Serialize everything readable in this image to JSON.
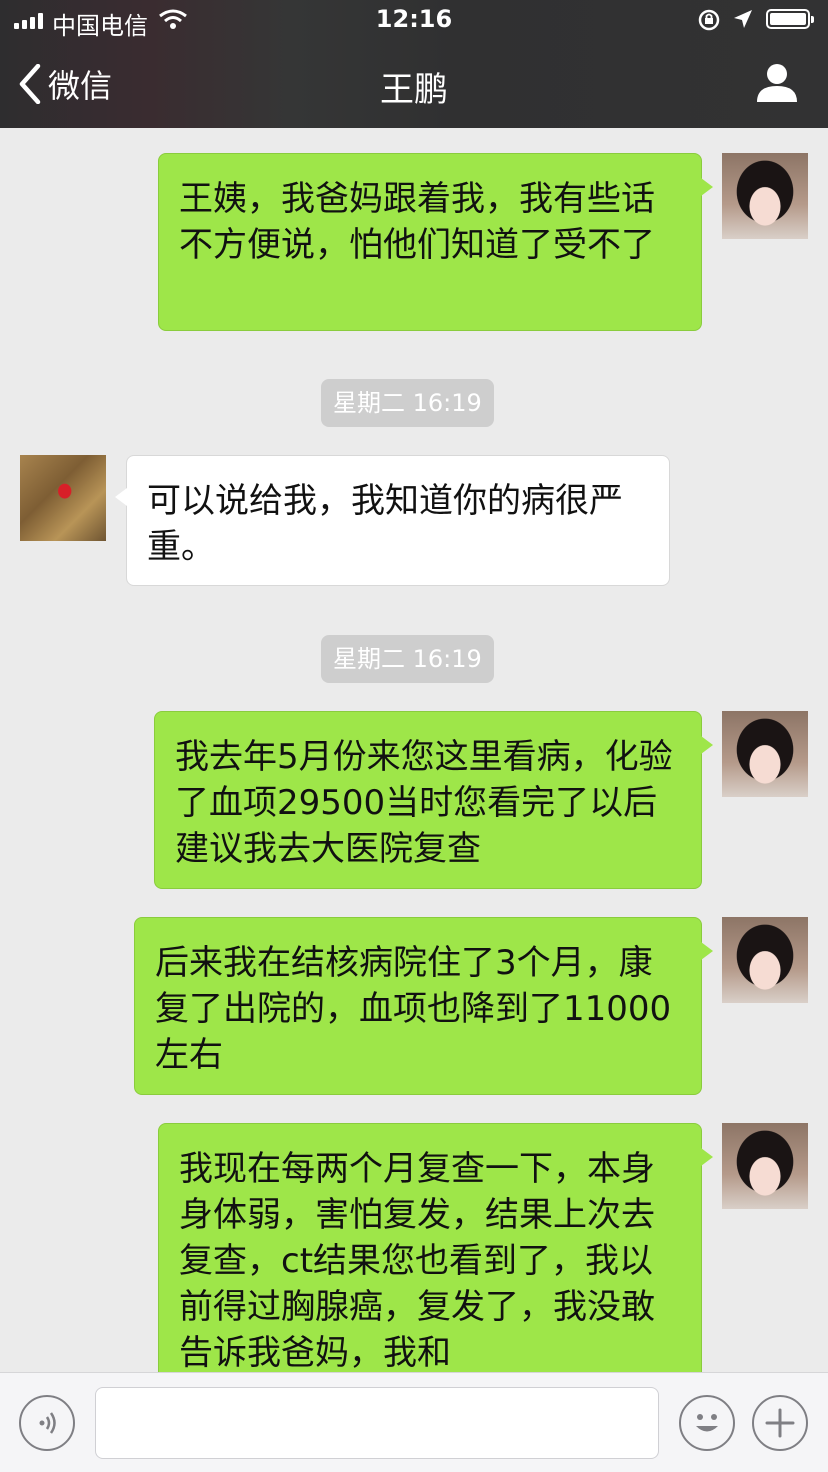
{
  "status_bar": {
    "carrier": "中国电信",
    "time": "12:16"
  },
  "nav": {
    "back_label": "微信",
    "title": "王鹏"
  },
  "messages": [
    {
      "side": "me",
      "text": "王姨，我爸妈跟着我，我有些话不方便说，怕他们知道了受不了"
    },
    {
      "timestamp": "星期二 16:19"
    },
    {
      "side": "them",
      "text": "可以说给我，我知道你的病很严重。"
    },
    {
      "timestamp": "星期二 16:19"
    },
    {
      "side": "me",
      "text": "我去年5月份来您这里看病，化验了血项29500当时您看完了以后建议我去大医院复查"
    },
    {
      "side": "me",
      "text": "后来我在结核病院住了3个月，康复了出院的，血项也降到了11000左右"
    },
    {
      "side": "me",
      "text": "我现在每两个月复查一下，本身身体弱，害怕复发，结果上次去复查，ct结果您也看到了，我以前得过胸腺癌，复发了，我没敢告诉我爸妈，我和"
    }
  ],
  "input": {
    "value": "",
    "placeholder": ""
  },
  "icons": {
    "back": "chevron-left-icon",
    "profile": "person-icon",
    "voice": "voice-icon",
    "emoji": "emoji-icon",
    "plus": "plus-icon"
  }
}
